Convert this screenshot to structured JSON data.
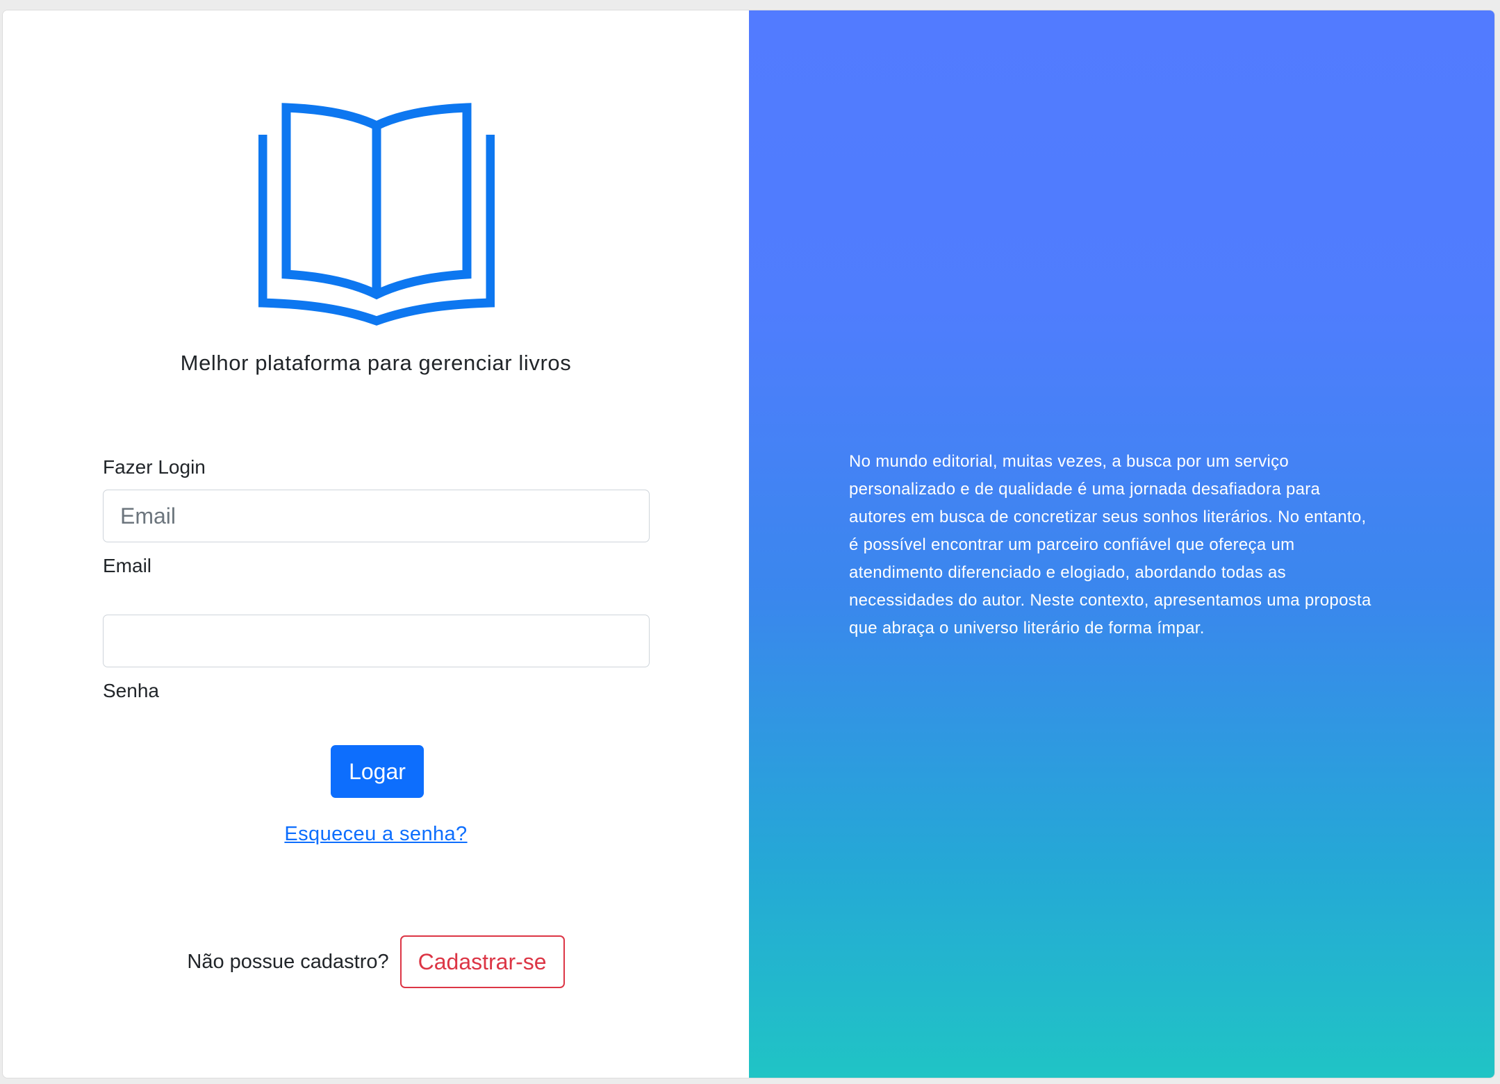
{
  "brand": {
    "logo_icon": "open-book-icon",
    "accent_color": "#0d6efd",
    "tagline": "Melhor plataforma para gerenciar livros"
  },
  "login": {
    "heading": "Fazer Login",
    "email": {
      "placeholder": "Email",
      "value": "",
      "label": "Email"
    },
    "password": {
      "placeholder": "",
      "value": "",
      "label": "Senha"
    },
    "submit_label": "Logar",
    "forgot_label": "Esqueceu a senha?"
  },
  "signup": {
    "prompt": "Não possue cadastro?",
    "button_label": "Cadastrar-se",
    "color": "#dc3545"
  },
  "promo": {
    "gradient_top": "#527bff",
    "gradient_bottom": "#20c4c5",
    "lines": [
      "No mundo editorial, muitas vezes, a busca por um serviço",
      "personalizado e de qualidade é uma jornada desafiadora para",
      "autores em busca de concretizar seus sonhos literários. No entanto,",
      "é possível encontrar um parceiro confiável que ofereça um",
      "atendimento diferenciado e elogiado, abordando todas as",
      "necessidades do autor. Neste contexto, apresentamos uma proposta",
      "que abraça o universo literário de forma ímpar."
    ]
  }
}
